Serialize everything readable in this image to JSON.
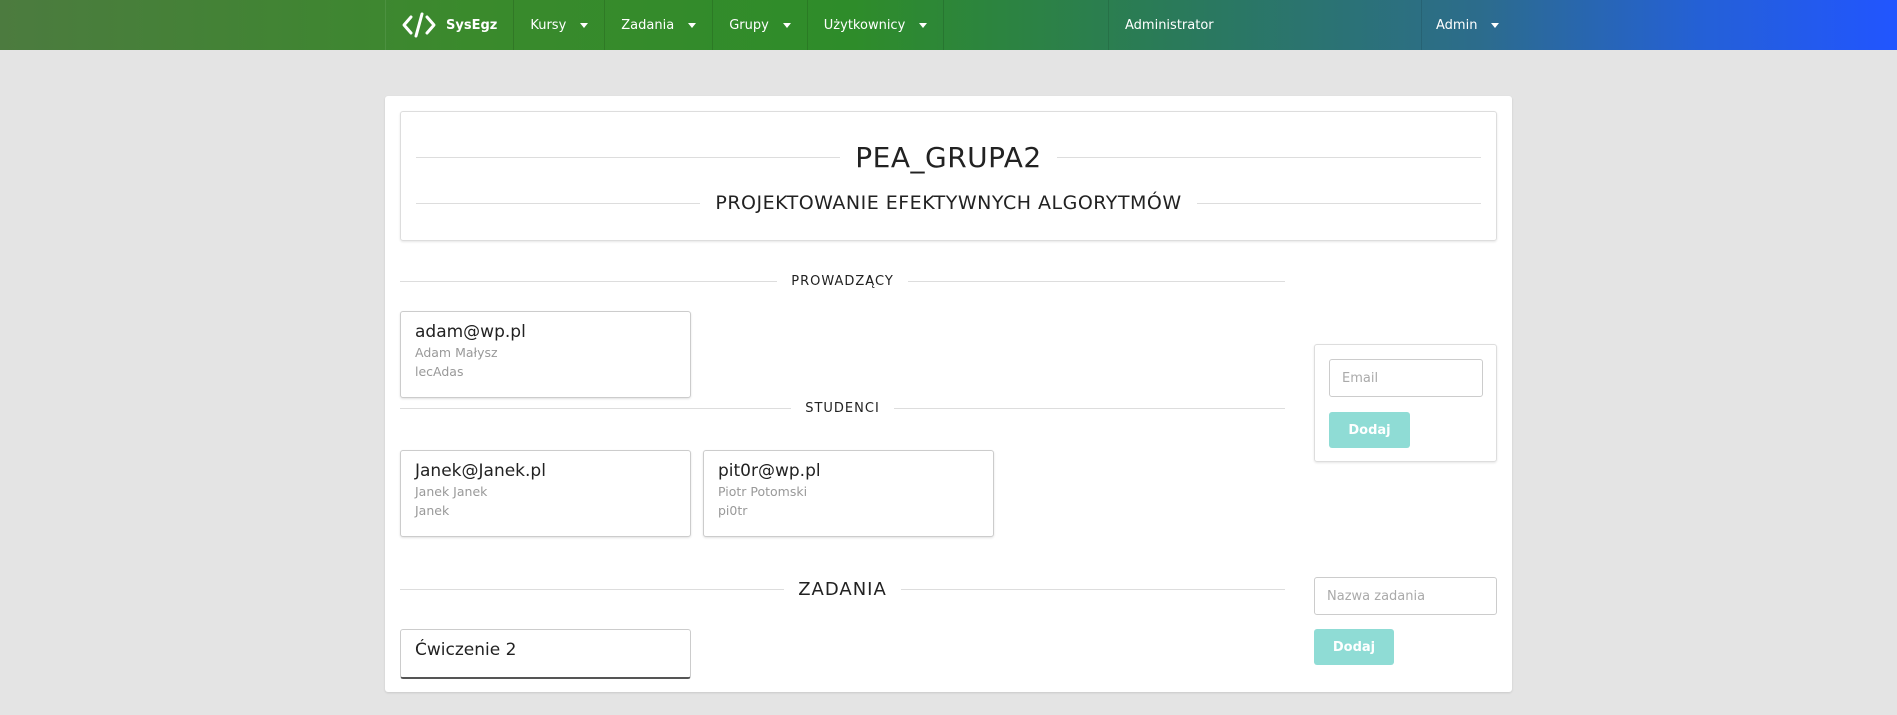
{
  "nav": {
    "brand": "SysEgz",
    "menus": [
      "Kursy",
      "Zadania",
      "Grupy",
      "Użytkownicy"
    ],
    "role": "Administrator",
    "user": "Admin"
  },
  "group": {
    "code": "PEA_GRUPA2",
    "course": "PROJEKTOWANIE EFEKTYWNYCH ALGORYTMÓW"
  },
  "sections": {
    "lecturers": "PROWADZĄCY",
    "students": "STUDENCI",
    "tasks": "ZADANIA"
  },
  "lecturers": [
    {
      "email": "adam@wp.pl",
      "name": "Adam Małysz",
      "login": "lecAdas"
    }
  ],
  "students": [
    {
      "email": "Janek@Janek.pl",
      "name": "Janek Janek",
      "login": "Janek"
    },
    {
      "email": "pit0r@wp.pl",
      "name": "Piotr Potomski",
      "login": "pi0tr"
    }
  ],
  "tasks": [
    "Ćwiczenie 2"
  ],
  "forms": {
    "email_placeholder": "Email",
    "task_placeholder": "Nazwa zadania",
    "add_label": "Dodaj"
  },
  "colors": {
    "button": "#8fdcd5",
    "nav_start": "#4c7b3f",
    "nav_end": "#2255ff"
  }
}
